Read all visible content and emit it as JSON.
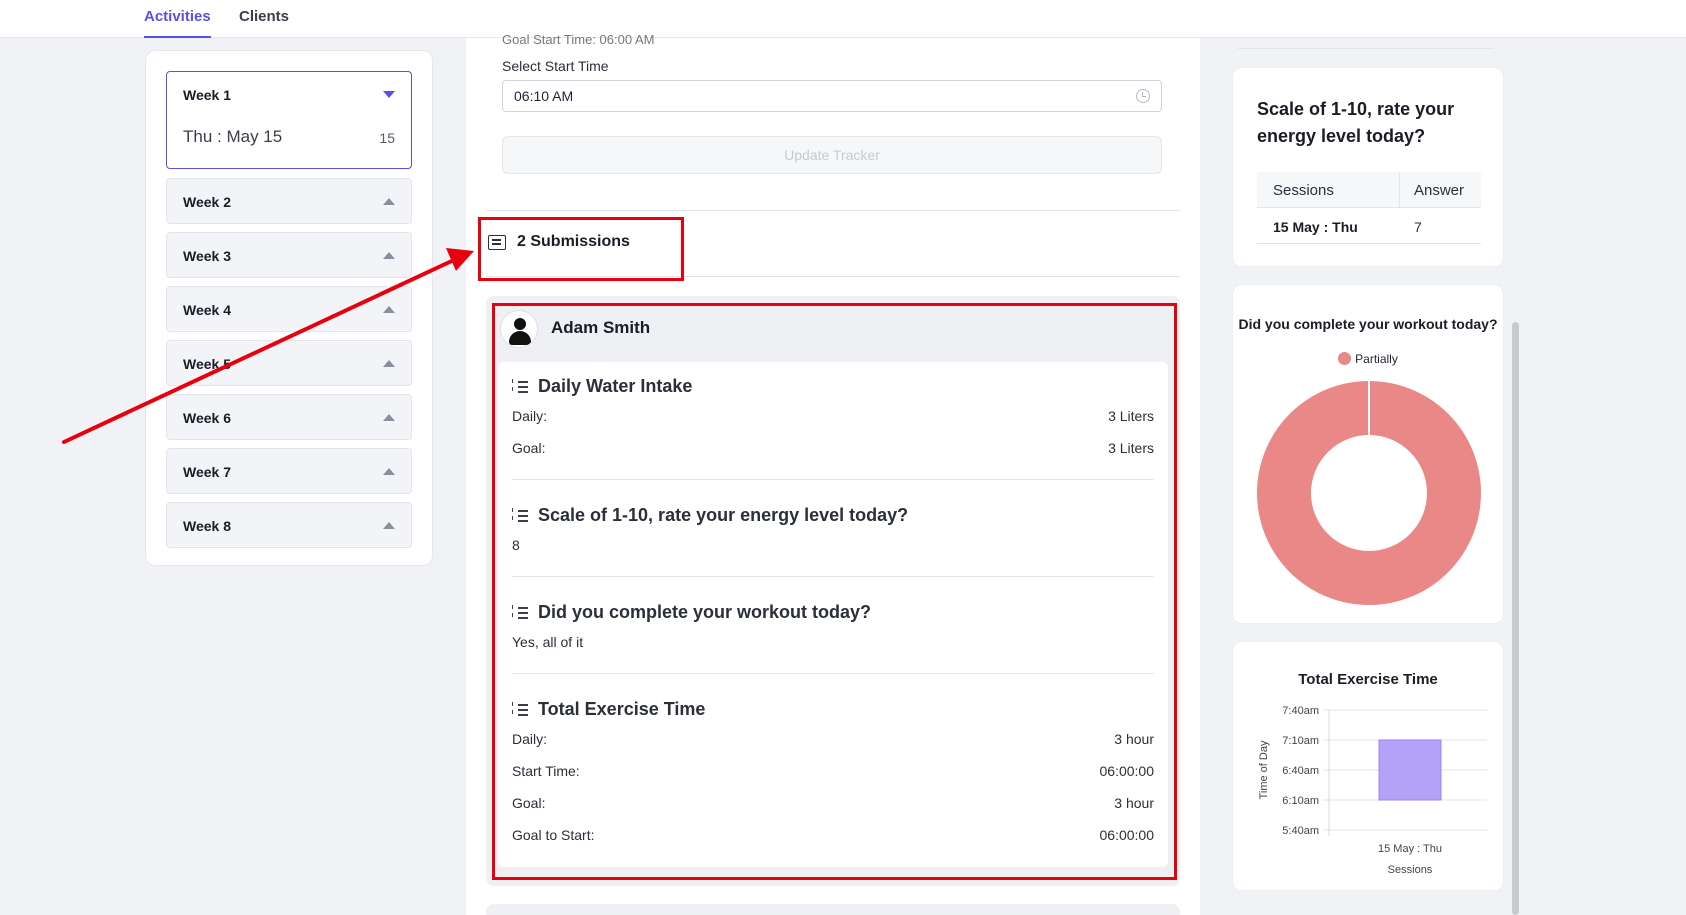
{
  "nav": {
    "tabs": [
      {
        "label": "Activities",
        "active": true
      },
      {
        "label": "Clients",
        "active": false
      }
    ]
  },
  "weeks": {
    "selected": {
      "label": "Week 1",
      "day": "Thu : May 15",
      "count": "15"
    },
    "others": [
      "Week 2",
      "Week 3",
      "Week 4",
      "Week 5",
      "Week 6",
      "Week 7",
      "Week 8"
    ]
  },
  "tracker": {
    "goal_start_cut": "Goal Start Time: 06:00 AM",
    "select_label": "Select Start Time",
    "start_time_value": "06:10 AM",
    "update_label": "Update Tracker"
  },
  "submissions": {
    "label": "2 Submissions"
  },
  "submission": {
    "user": "Adam Smith",
    "sections": {
      "water": {
        "title": "Daily Water Intake",
        "daily_label": "Daily:",
        "daily_value": "3 Liters",
        "goal_label": "Goal:",
        "goal_value": "3 Liters"
      },
      "energy": {
        "title": "Scale of 1-10, rate your energy level today?",
        "answer": "8"
      },
      "workout": {
        "title": "Did you complete your workout today?",
        "answer": "Yes, all of it"
      },
      "exercise": {
        "title": "Total Exercise Time",
        "daily_label": "Daily:",
        "daily_value": "3 hour",
        "start_label": "Start Time:",
        "start_value": "06:00:00",
        "goal_label": "Goal:",
        "goal_value": "3 hour",
        "goal_start_label": "Goal to Start:",
        "goal_start_value": "06:00:00"
      }
    }
  },
  "right": {
    "energy_card": {
      "title": "Scale of 1-10, rate your energy level today?",
      "col_sessions": "Sessions",
      "col_answer": "Answer",
      "row_session": "15 May : Thu",
      "row_answer": "7"
    },
    "workout_card": {
      "title": "Did you complete your workout today?",
      "legend": "Partially"
    },
    "exercise_card": {
      "title": "Total Exercise Time"
    }
  },
  "colors": {
    "accent": "#5b50e6",
    "donut": "#e98886",
    "bar": "#b3a2f7",
    "annotation": "#e8000f"
  },
  "chart_data": [
    {
      "type": "pie",
      "title": "Did you complete your workout today?",
      "legend": [
        "Partially"
      ],
      "categories": [
        "Partially"
      ],
      "values": [
        1
      ],
      "donut": true
    },
    {
      "type": "bar",
      "title": "Total Exercise Time",
      "xlabel": "Sessions",
      "ylabel": "Time of Day",
      "categories": [
        "15 May : Thu"
      ],
      "yticks": [
        "5:40am",
        "6:10am",
        "6:40am",
        "7:10am",
        "7:40am"
      ],
      "floating_bar": {
        "start": "6:10am",
        "end": "7:10am"
      },
      "grid": true
    }
  ]
}
